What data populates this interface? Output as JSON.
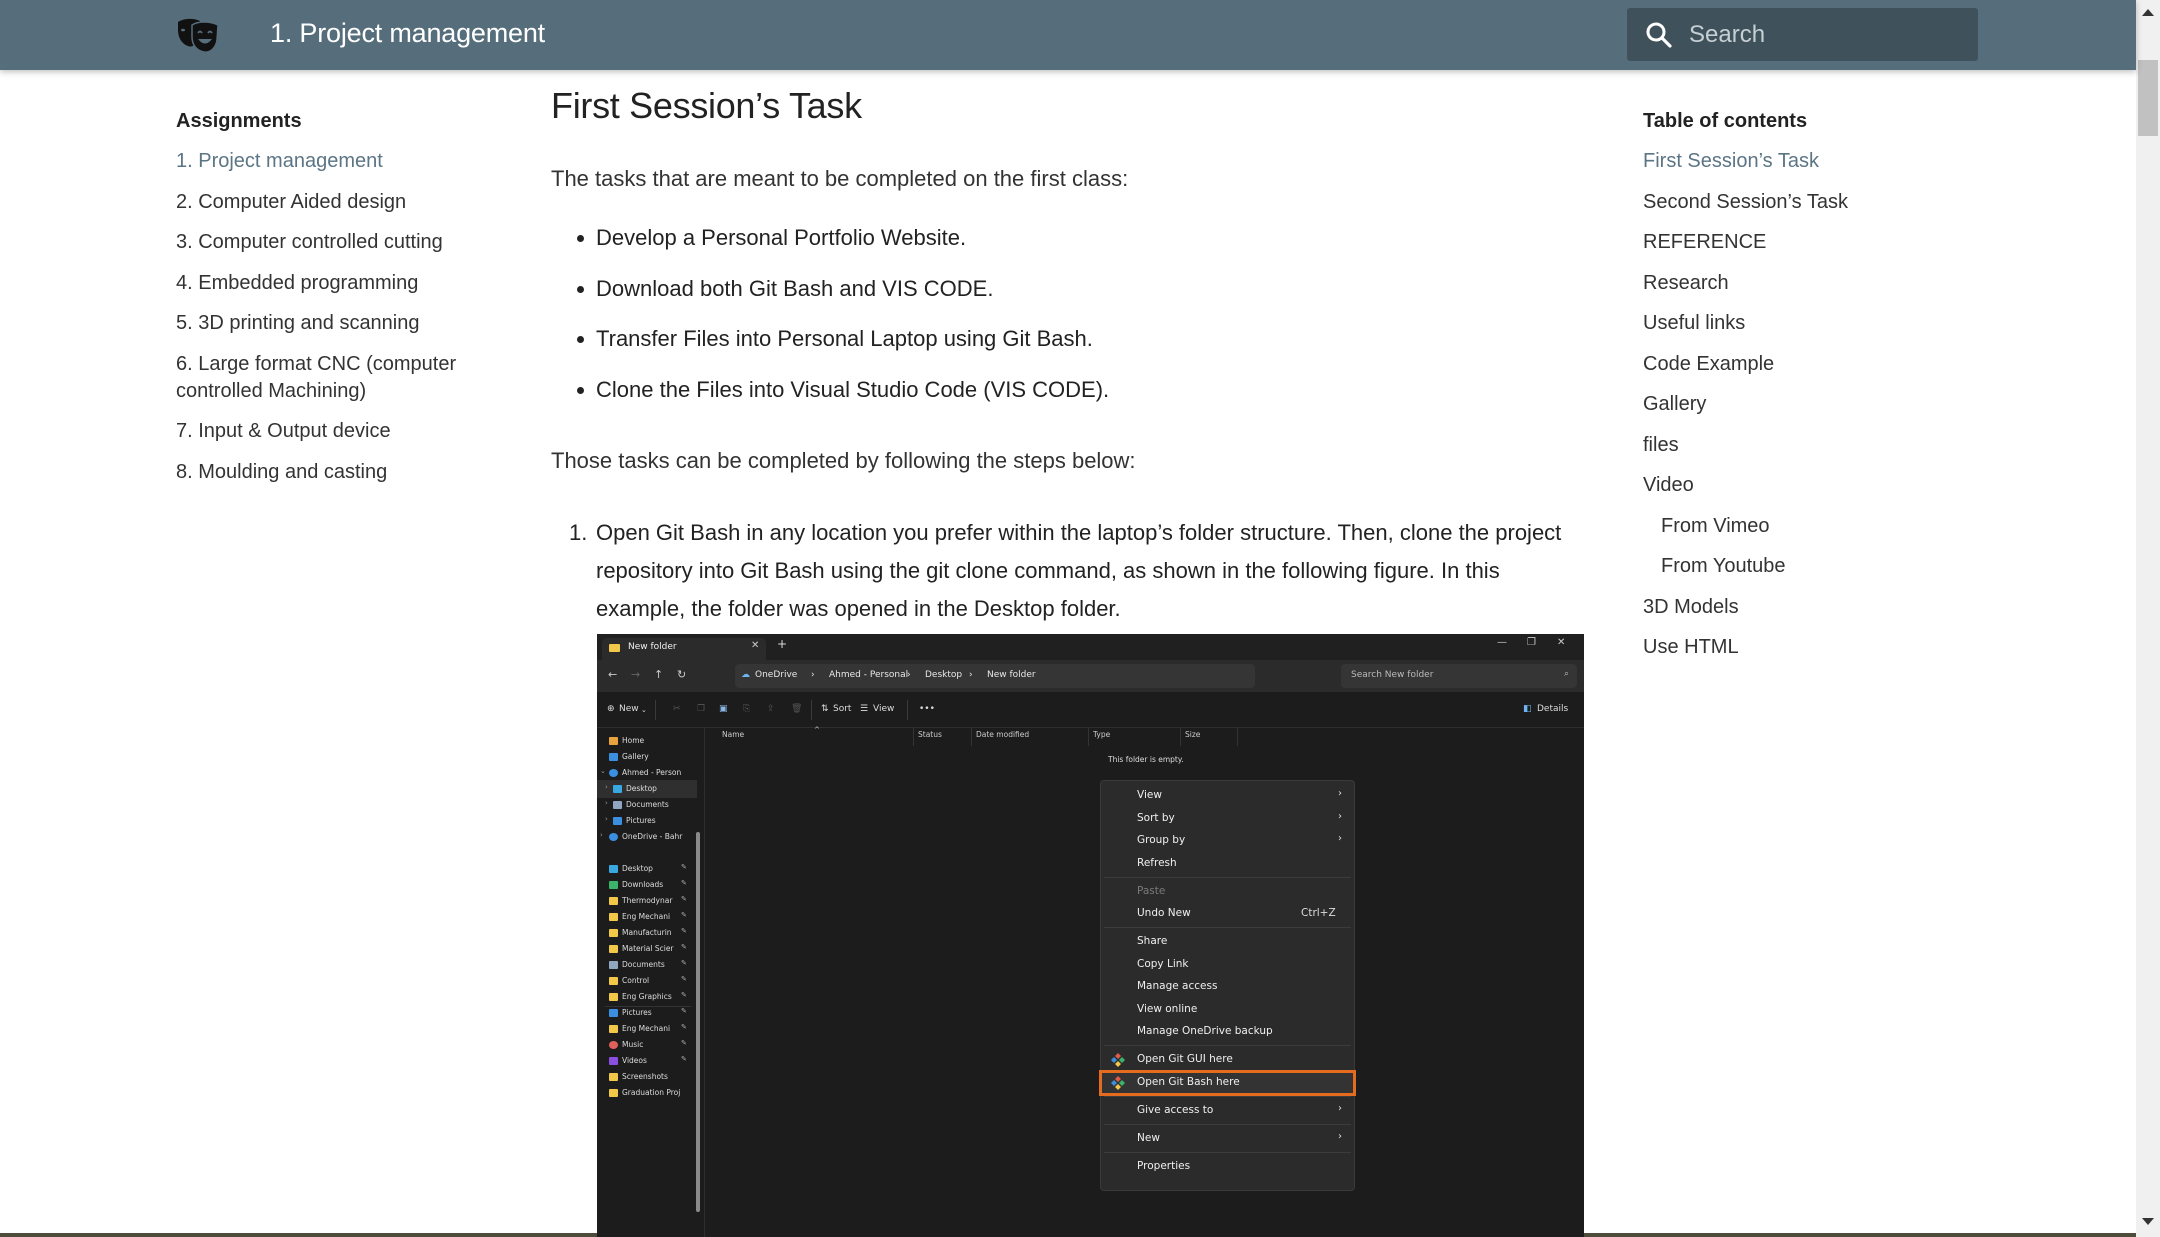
{
  "header": {
    "title": "1. Project management",
    "logo_icon": "theater-masks-icon",
    "search_placeholder": "Search"
  },
  "left_nav": {
    "heading": "Assignments",
    "items": [
      {
        "label": "1. Project management",
        "active": true
      },
      {
        "label": "2. Computer Aided design"
      },
      {
        "label": "3. Computer controlled cutting"
      },
      {
        "label": "4. Embedded programming"
      },
      {
        "label": "5. 3D printing and scanning"
      },
      {
        "label": "6. Large format CNC (computer controlled Machining)"
      },
      {
        "label": "7. Input & Output device"
      },
      {
        "label": "8. Moulding and casting"
      }
    ]
  },
  "main": {
    "title": "First Session’s Task",
    "intro": "The tasks that are meant to be completed on the first class:",
    "tasks": [
      "Develop a Personal Portfolio Website.",
      "Download both Git Bash and VIS CODE.",
      "Transfer Files into Personal Laptop using Git Bash.",
      "Clone the Files into Visual Studio Code (VIS CODE)."
    ],
    "steps_intro": "Those tasks can be completed by following the steps below:",
    "steps": [
      {
        "number": "1.",
        "text": "Open Git Bash in any location you prefer within the laptop’s folder structure. Then, clone the project repository into Git Bash using the git clone command, as shown in the following figure. In this example, the folder was opened in the Desktop folder."
      }
    ]
  },
  "figure": {
    "tab_label": "New folder",
    "breadcrumbs": [
      "OneDrive",
      "Ahmed - Personal",
      "Desktop",
      "New folder"
    ],
    "search_placeholder": "Search New folder",
    "toolbar": {
      "new": "New",
      "sort": "Sort",
      "view": "View",
      "more": "•••",
      "details": "Details"
    },
    "columns": [
      "Name",
      "Status",
      "Date modified",
      "Type",
      "Size"
    ],
    "empty_text": "This folder is empty.",
    "sidebar": [
      {
        "label": "Home",
        "icon": "home",
        "color": "#e8a33d"
      },
      {
        "label": "Gallery",
        "icon": "gallery",
        "color": "#3a8fe0"
      },
      {
        "label": "Ahmed - Person",
        "icon": "cloud",
        "color": "#3a8fe0",
        "chevron": "down"
      },
      {
        "label": "Desktop",
        "icon": "desktop",
        "color": "#3aa8e0",
        "chevron": "right",
        "selected": true
      },
      {
        "label": "Documents",
        "icon": "document",
        "color": "#8fa8c0",
        "chevron": "right"
      },
      {
        "label": "Pictures",
        "icon": "pictures",
        "color": "#3a8fe0",
        "chevron": "right"
      },
      {
        "label": "OneDrive - Bahr",
        "icon": "cloud",
        "color": "#3a8fe0",
        "chevron": "right"
      },
      {
        "label": "Desktop",
        "icon": "desktop",
        "color": "#3aa8e0",
        "pinned": true
      },
      {
        "label": "Downloads",
        "icon": "download",
        "color": "#3bb36b",
        "pinned": true
      },
      {
        "label": "Thermodynar",
        "icon": "folder",
        "color": "#f2c84b",
        "pinned": true
      },
      {
        "label": "Eng Mechani",
        "icon": "folder",
        "color": "#f2c84b",
        "pinned": true
      },
      {
        "label": "Manufacturin",
        "icon": "folder",
        "color": "#f2c84b",
        "pinned": true
      },
      {
        "label": "Material Scier",
        "icon": "folder",
        "color": "#f2c84b",
        "pinned": true
      },
      {
        "label": "Documents",
        "icon": "document",
        "color": "#8fa8c0",
        "pinned": true
      },
      {
        "label": "Control",
        "icon": "folder",
        "color": "#f2c84b",
        "pinned": true
      },
      {
        "label": "Eng Graphics",
        "icon": "folder",
        "color": "#f2c84b",
        "pinned": true
      },
      {
        "label": "Pictures",
        "icon": "pictures",
        "color": "#3a8fe0",
        "pinned": true
      },
      {
        "label": "Eng Mechani",
        "icon": "folder",
        "color": "#f2c84b",
        "pinned": true
      },
      {
        "label": "Music",
        "icon": "music",
        "color": "#e0605a",
        "pinned": true
      },
      {
        "label": "Videos",
        "icon": "videos",
        "color": "#8a4fe0",
        "pinned": true
      },
      {
        "label": "Screenshots",
        "icon": "folder",
        "color": "#f2c84b"
      },
      {
        "label": "Graduation Proj",
        "icon": "folder",
        "color": "#f2c84b"
      }
    ],
    "context_menu": [
      {
        "label": "View",
        "submenu": true
      },
      {
        "label": "Sort by",
        "submenu": true
      },
      {
        "label": "Group by",
        "submenu": true
      },
      {
        "label": "Refresh"
      },
      {
        "separator": true
      },
      {
        "label": "Paste",
        "disabled": true
      },
      {
        "label": "Undo New",
        "shortcut": "Ctrl+Z"
      },
      {
        "separator": true
      },
      {
        "label": "Share"
      },
      {
        "label": "Copy Link"
      },
      {
        "label": "Manage access"
      },
      {
        "label": "View online"
      },
      {
        "label": "Manage OneDrive backup"
      },
      {
        "separator": true
      },
      {
        "label": "Open Git GUI here",
        "icon": "git"
      },
      {
        "label": "Open Git Bash here",
        "icon": "git",
        "highlighted": true
      },
      {
        "separator": true
      },
      {
        "label": "Give access to",
        "submenu": true
      },
      {
        "separator": true
      },
      {
        "label": "New",
        "submenu": true
      },
      {
        "separator": true
      },
      {
        "label": "Properties"
      }
    ],
    "highlight_color": "#e56b1f"
  },
  "toc": {
    "heading": "Table of contents",
    "items": [
      {
        "label": "First Session’s Task",
        "active": true,
        "level": 1
      },
      {
        "label": "Second Session’s Task",
        "level": 1
      },
      {
        "label": "REFERENCE",
        "level": 1
      },
      {
        "label": "Research",
        "level": 1
      },
      {
        "label": "Useful links",
        "level": 1
      },
      {
        "label": "Code Example",
        "level": 1
      },
      {
        "label": "Gallery",
        "level": 1
      },
      {
        "label": "files",
        "level": 1
      },
      {
        "label": "Video",
        "level": 1
      },
      {
        "label": "From Vimeo",
        "level": 2
      },
      {
        "label": "From Youtube",
        "level": 2
      },
      {
        "label": "3D Models",
        "level": 1
      },
      {
        "label": "Use HTML",
        "level": 1
      }
    ]
  },
  "colors": {
    "header_bg": "#566e7b",
    "search_bg": "#3f525b",
    "active_link": "#5c7585"
  }
}
